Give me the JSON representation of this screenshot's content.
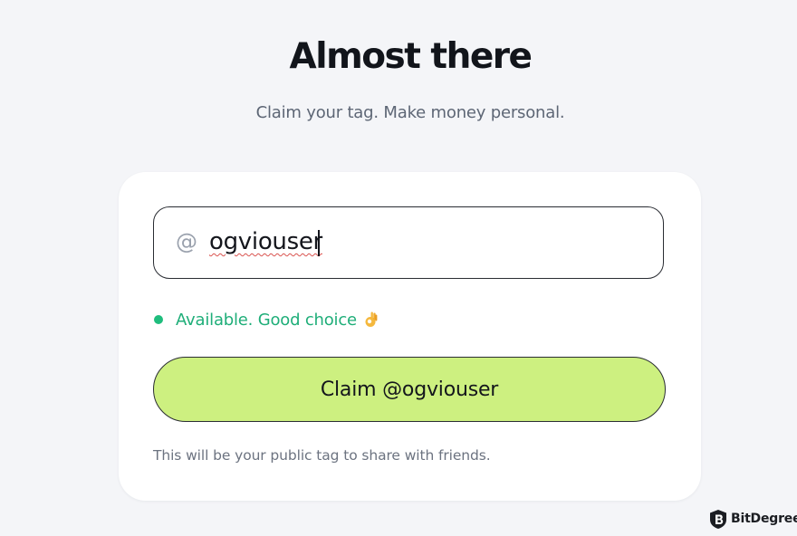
{
  "header": {
    "title": "Almost there",
    "subtitle": "Claim your tag. Make money personal."
  },
  "tag_input": {
    "prefix": "@",
    "value": "ogviouser"
  },
  "availability": {
    "message": "Available. Good choice",
    "icon": "ok-hand-emoji",
    "color": "#1fae79"
  },
  "claim_button": {
    "label": "Claim @ogviouser",
    "color": "#cdf080"
  },
  "hint": "This will be your public tag to share with friends.",
  "watermark": {
    "text": "BitDegree"
  }
}
